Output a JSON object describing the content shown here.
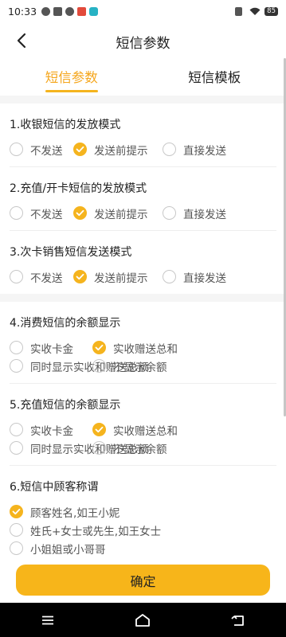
{
  "status_bar": {
    "time": "10:33",
    "battery": "85"
  },
  "nav": {
    "title": "短信参数"
  },
  "tabs": [
    {
      "label": "短信参数",
      "active": true
    },
    {
      "label": "短信模板",
      "active": false
    }
  ],
  "cards": [
    {
      "sections": [
        {
          "title": "1.收银短信的发放模式",
          "rows": [
            [
              {
                "label": "不发送",
                "checked": false
              },
              {
                "label": "发送前提示",
                "checked": true
              },
              {
                "label": "直接发送",
                "checked": false
              }
            ]
          ]
        },
        {
          "title": "2.充值/开卡短信的发放模式",
          "rows": [
            [
              {
                "label": "不发送",
                "checked": false
              },
              {
                "label": "发送前提示",
                "checked": true
              },
              {
                "label": "直接发送",
                "checked": false
              }
            ]
          ]
        },
        {
          "title": "3.次卡销售短信发送模式",
          "rows": [
            [
              {
                "label": "不发送",
                "checked": false
              },
              {
                "label": "发送前提示",
                "checked": true
              },
              {
                "label": "直接发送",
                "checked": false
              }
            ]
          ]
        }
      ]
    },
    {
      "sections": [
        {
          "title": "4.消费短信的余额显示",
          "rows": [
            [
              {
                "label": "实收卡金",
                "checked": false
              },
              {
                "label": "实收赠送总和",
                "checked": true
              }
            ],
            [
              {
                "label": "同时显示实收和赠送总额",
                "checked": false
              },
              {
                "label": "不显示余额",
                "checked": false
              }
            ]
          ]
        },
        {
          "title": "5.充值短信的余额显示",
          "rows": [
            [
              {
                "label": "实收卡金",
                "checked": false
              },
              {
                "label": "实收赠送总和",
                "checked": true
              }
            ],
            [
              {
                "label": "同时显示实收和赠送总额",
                "checked": false
              },
              {
                "label": "不显示余额",
                "checked": false
              }
            ]
          ]
        },
        {
          "title": "6.短信中顾客称谓",
          "rows": [
            [
              {
                "label": "顾客姓名,如王小妮",
                "checked": true
              }
            ],
            [
              {
                "label": "姓氏+女士或先生,如王女士",
                "checked": false
              }
            ],
            [
              {
                "label": "小姐姐或小哥哥",
                "checked": false
              }
            ]
          ]
        }
      ]
    }
  ],
  "confirm_button": {
    "label": "确定"
  },
  "colors": {
    "accent": "#f5b41e",
    "button": "#f7b51a",
    "tab_active_text": "#f5a61c"
  }
}
